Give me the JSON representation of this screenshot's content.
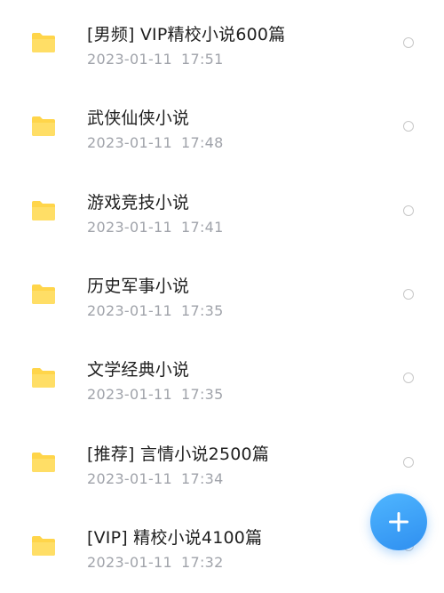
{
  "files": [
    {
      "name": "[男频] VIP精校小说600篇",
      "date": "2023-01-11",
      "time": "17:51"
    },
    {
      "name": "武侠仙侠小说",
      "date": "2023-01-11",
      "time": "17:48"
    },
    {
      "name": "游戏竞技小说",
      "date": "2023-01-11",
      "time": "17:41"
    },
    {
      "name": "历史军事小说",
      "date": "2023-01-11",
      "time": "17:35"
    },
    {
      "name": "文学经典小说",
      "date": "2023-01-11",
      "time": "17:35"
    },
    {
      "name": "[推荐] 言情小说2500篇",
      "date": "2023-01-11",
      "time": "17:34"
    },
    {
      "name": "[VIP] 精校小说4100篇",
      "date": "2023-01-11",
      "time": "17:32"
    }
  ],
  "icons": {
    "folder": "folder-icon",
    "select": "radio-circle",
    "fab": "plus-icon"
  },
  "colors": {
    "folder": "#FFD54A",
    "accent": "#3A9BF5",
    "title_text": "#1F1F1F",
    "meta_text": "#A0A3AA"
  }
}
